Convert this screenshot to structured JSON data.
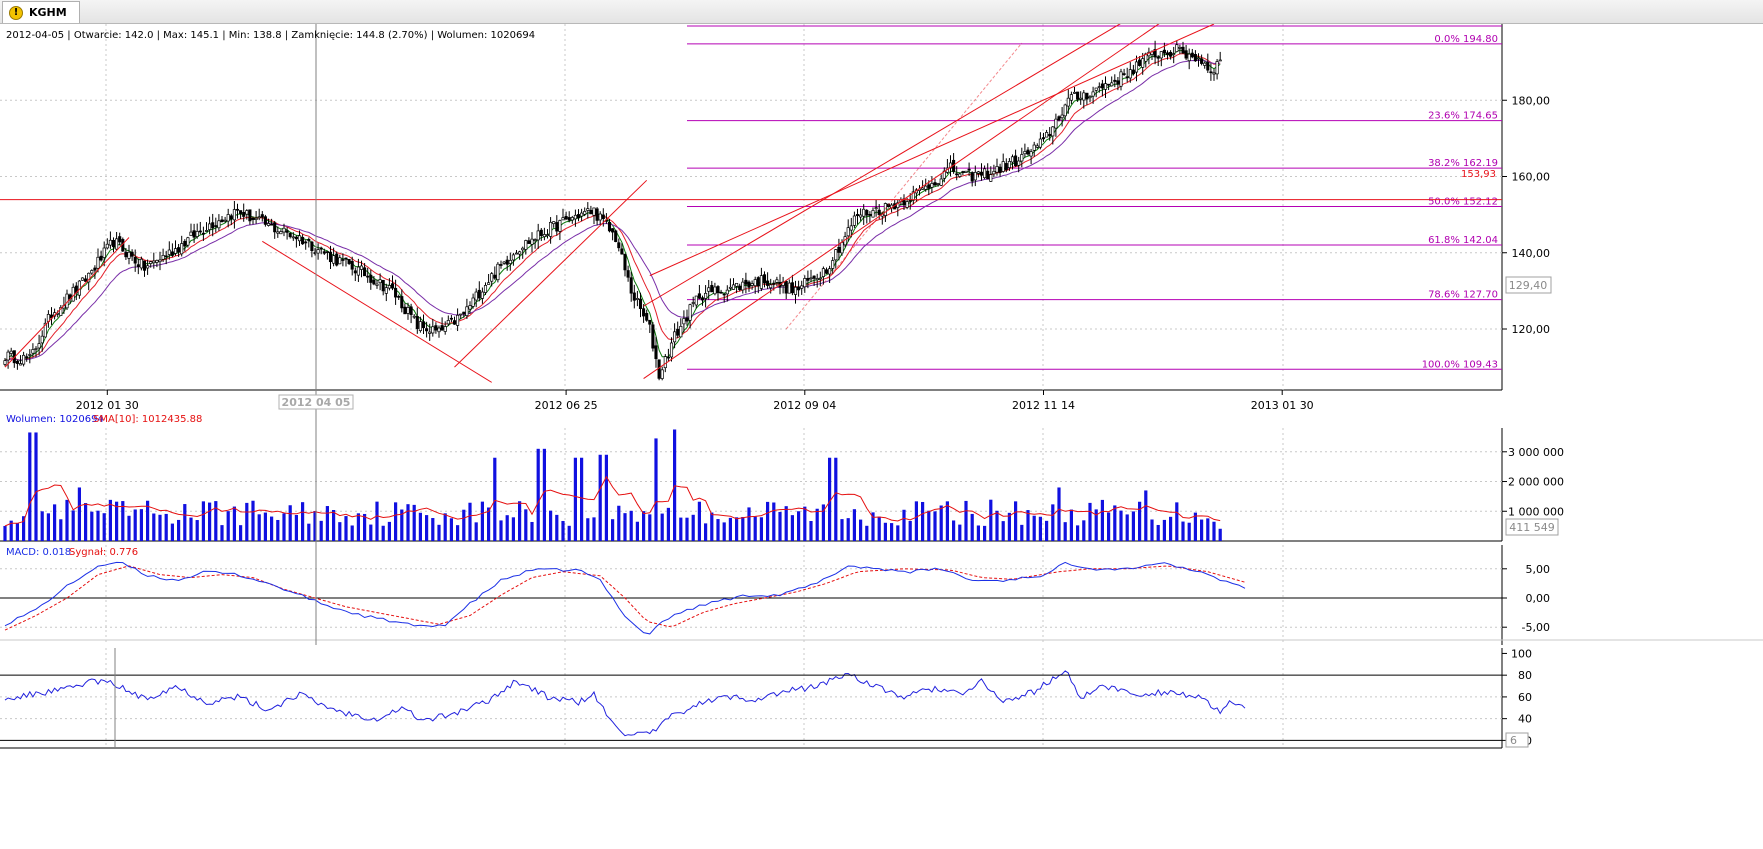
{
  "tab": {
    "title": "KGHM",
    "icon": "warning-icon"
  },
  "info_line": "2012-04-05 | Otwarcie: 142.0 | Max: 145.1 | Min: 138.8 | Zamknięcie: 144.8 (2.70%)  | Wolumen: 1020694",
  "colors": {
    "price_line": "#e8131b",
    "fib_line": "#b400b4",
    "fib_text": "#b000b0",
    "ema_green": "#0c7a0c",
    "ema_red": "#e4202a",
    "ema_purple": "#7a2fa8",
    "volume_bar": "#1010e0",
    "volume_sma": "#e51010",
    "macd": "#1a2fe6",
    "signal": "#e51010",
    "oscillator": "#2222dd"
  },
  "chart_data": [
    {
      "type": "candlestick",
      "name": "price",
      "x_tick_labels": [
        "2012 01 30",
        "2012 06 25",
        "2012 09 04",
        "2012 11 14",
        "2013 01 30"
      ],
      "cursor_label": "2012 04 05",
      "y_ticks": [
        "120,00",
        "140,00",
        "160,00",
        "180,00"
      ],
      "ylim": [
        104,
        200
      ],
      "last_price_label": "129,40",
      "horizontal_level": {
        "value": 153.93,
        "label": "153,93"
      },
      "fibonacci": [
        {
          "label": "0.0% 194.80",
          "value": 194.8
        },
        {
          "label": "23.6% 174.65",
          "value": 174.65
        },
        {
          "label": "38.2% 162.19",
          "value": 162.19
        },
        {
          "label": "50.0% 152.12",
          "value": 152.12
        },
        {
          "label": "61.8% 142.04",
          "value": 142.04
        },
        {
          "label": "78.6% 127.70",
          "value": 127.7
        },
        {
          "label": "100.0% 109.43",
          "value": 109.43
        }
      ],
      "close_anchors": [
        [
          0,
          113
        ],
        [
          8,
          112
        ],
        [
          15,
          124
        ],
        [
          25,
          132
        ],
        [
          35,
          143
        ],
        [
          45,
          136
        ],
        [
          55,
          141
        ],
        [
          65,
          147
        ],
        [
          75,
          151
        ],
        [
          85,
          147
        ],
        [
          95,
          144
        ],
        [
          105,
          139
        ],
        [
          115,
          135
        ],
        [
          125,
          130
        ],
        [
          133,
          121
        ],
        [
          140,
          119
        ],
        [
          148,
          124
        ],
        [
          155,
          132
        ],
        [
          165,
          141
        ],
        [
          175,
          146
        ],
        [
          185,
          150
        ],
        [
          190,
          151
        ],
        [
          197,
          144
        ],
        [
          202,
          130
        ],
        [
          208,
          120
        ],
        [
          211,
          108
        ],
        [
          216,
          118
        ],
        [
          224,
          129
        ],
        [
          235,
          131
        ],
        [
          245,
          133
        ],
        [
          255,
          130
        ],
        [
          265,
          136
        ],
        [
          275,
          150
        ],
        [
          285,
          152
        ],
        [
          295,
          156
        ],
        [
          305,
          162
        ],
        [
          310,
          160
        ],
        [
          318,
          161
        ],
        [
          328,
          165
        ],
        [
          335,
          169
        ],
        [
          343,
          180
        ],
        [
          350,
          182
        ],
        [
          360,
          186
        ],
        [
          370,
          192
        ],
        [
          378,
          193
        ],
        [
          385,
          191
        ],
        [
          389,
          188
        ],
        [
          392,
          190
        ]
      ]
    },
    {
      "type": "bar",
      "name": "volume",
      "label_volume": "Wolumen: 1020694",
      "label_sma": "SMA[10]: 1012435.88",
      "y_ticks": [
        "1 000 000",
        "2 000 000",
        "3 000 000"
      ],
      "ylim": [
        0,
        3800000
      ],
      "last_value_label": "411 549",
      "spikes": [
        {
          "at": 9,
          "value": 3650000
        },
        {
          "at": 24,
          "value": 1800000
        },
        {
          "at": 158,
          "value": 2800000
        },
        {
          "at": 173,
          "value": 3100000
        },
        {
          "at": 185,
          "value": 2800000
        },
        {
          "at": 193,
          "value": 2900000
        },
        {
          "at": 210,
          "value": 3450000
        },
        {
          "at": 216,
          "value": 3750000
        },
        {
          "at": 267,
          "value": 2800000
        },
        {
          "at": 340,
          "value": 1800000
        },
        {
          "at": 368,
          "value": 1700000
        }
      ],
      "last_value": 411549
    },
    {
      "type": "line",
      "name": "macd",
      "label_macd": "MACD: 0.018",
      "label_signal": "Sygnał: 0.776",
      "y_ticks": [
        "-5,00",
        "0,00",
        "5,00"
      ],
      "ylim": [
        -7,
        8
      ],
      "macd_anchors": [
        [
          0,
          -4.5
        ],
        [
          10,
          -2
        ],
        [
          20,
          2
        ],
        [
          30,
          5.5
        ],
        [
          38,
          6
        ],
        [
          45,
          4
        ],
        [
          55,
          3
        ],
        [
          65,
          4.5
        ],
        [
          75,
          4
        ],
        [
          85,
          2.5
        ],
        [
          95,
          0.5
        ],
        [
          105,
          -1.5
        ],
        [
          115,
          -3
        ],
        [
          125,
          -4
        ],
        [
          135,
          -5
        ],
        [
          142,
          -4.5
        ],
        [
          150,
          -1
        ],
        [
          160,
          3
        ],
        [
          170,
          4.8
        ],
        [
          185,
          4.8
        ],
        [
          192,
          3
        ],
        [
          200,
          -3
        ],
        [
          207,
          -6.5
        ],
        [
          212,
          -4
        ],
        [
          220,
          -2
        ],
        [
          230,
          -0.5
        ],
        [
          240,
          0.5
        ],
        [
          250,
          0.5
        ],
        [
          262,
          2.5
        ],
        [
          272,
          5.5
        ],
        [
          282,
          5
        ],
        [
          292,
          4.5
        ],
        [
          302,
          5
        ],
        [
          312,
          3
        ],
        [
          322,
          3
        ],
        [
          336,
          4
        ],
        [
          342,
          6
        ],
        [
          352,
          5
        ],
        [
          362,
          5
        ],
        [
          372,
          6
        ],
        [
          382,
          5
        ],
        [
          390,
          3.5
        ],
        [
          400,
          1.8
        ]
      ],
      "signal_anchors": [
        [
          0,
          -5.5
        ],
        [
          10,
          -3
        ],
        [
          20,
          0
        ],
        [
          30,
          4
        ],
        [
          40,
          5.5
        ],
        [
          50,
          4
        ],
        [
          60,
          3.5
        ],
        [
          70,
          4
        ],
        [
          80,
          3.5
        ],
        [
          90,
          1.5
        ],
        [
          100,
          0
        ],
        [
          110,
          -1.5
        ],
        [
          120,
          -2.5
        ],
        [
          130,
          -3.5
        ],
        [
          140,
          -4.5
        ],
        [
          150,
          -3
        ],
        [
          160,
          0.5
        ],
        [
          170,
          3.5
        ],
        [
          180,
          4.5
        ],
        [
          192,
          3.8
        ],
        [
          200,
          0
        ],
        [
          207,
          -4
        ],
        [
          215,
          -5
        ],
        [
          225,
          -2.5
        ],
        [
          235,
          -1
        ],
        [
          245,
          0
        ],
        [
          255,
          1
        ],
        [
          265,
          2.5
        ],
        [
          275,
          4.5
        ],
        [
          290,
          5
        ],
        [
          305,
          4.8
        ],
        [
          315,
          3.5
        ],
        [
          325,
          3.2
        ],
        [
          340,
          4.5
        ],
        [
          350,
          5
        ],
        [
          362,
          5
        ],
        [
          375,
          5.5
        ],
        [
          388,
          4.5
        ],
        [
          400,
          2.7
        ]
      ]
    },
    {
      "type": "line",
      "name": "oscillator",
      "y_ticks": [
        "20",
        "40",
        "60",
        "80",
        "100"
      ],
      "ylim": [
        13,
        105
      ],
      "last_value_label": "6",
      "levels": [
        20,
        80
      ],
      "anchors": [
        [
          0,
          57
        ],
        [
          10,
          63
        ],
        [
          20,
          67
        ],
        [
          28,
          75
        ],
        [
          35,
          72
        ],
        [
          45,
          58
        ],
        [
          55,
          70
        ],
        [
          65,
          55
        ],
        [
          75,
          60
        ],
        [
          85,
          48
        ],
        [
          95,
          63
        ],
        [
          100,
          55
        ],
        [
          110,
          45
        ],
        [
          120,
          40
        ],
        [
          128,
          50
        ],
        [
          135,
          38
        ],
        [
          145,
          45
        ],
        [
          155,
          55
        ],
        [
          165,
          75
        ],
        [
          175,
          60
        ],
        [
          185,
          55
        ],
        [
          190,
          62
        ],
        [
          196,
          35
        ],
        [
          200,
          27
        ],
        [
          208,
          25
        ],
        [
          214,
          40
        ],
        [
          222,
          52
        ],
        [
          232,
          60
        ],
        [
          242,
          58
        ],
        [
          252,
          65
        ],
        [
          262,
          70
        ],
        [
          272,
          82
        ],
        [
          280,
          70
        ],
        [
          290,
          60
        ],
        [
          300,
          68
        ],
        [
          310,
          62
        ],
        [
          315,
          75
        ],
        [
          322,
          55
        ],
        [
          332,
          65
        ],
        [
          342,
          84
        ],
        [
          347,
          60
        ],
        [
          355,
          70
        ],
        [
          365,
          62
        ],
        [
          375,
          65
        ],
        [
          385,
          60
        ],
        [
          392,
          45
        ],
        [
          395,
          54
        ],
        [
          400,
          52
        ]
      ]
    }
  ]
}
